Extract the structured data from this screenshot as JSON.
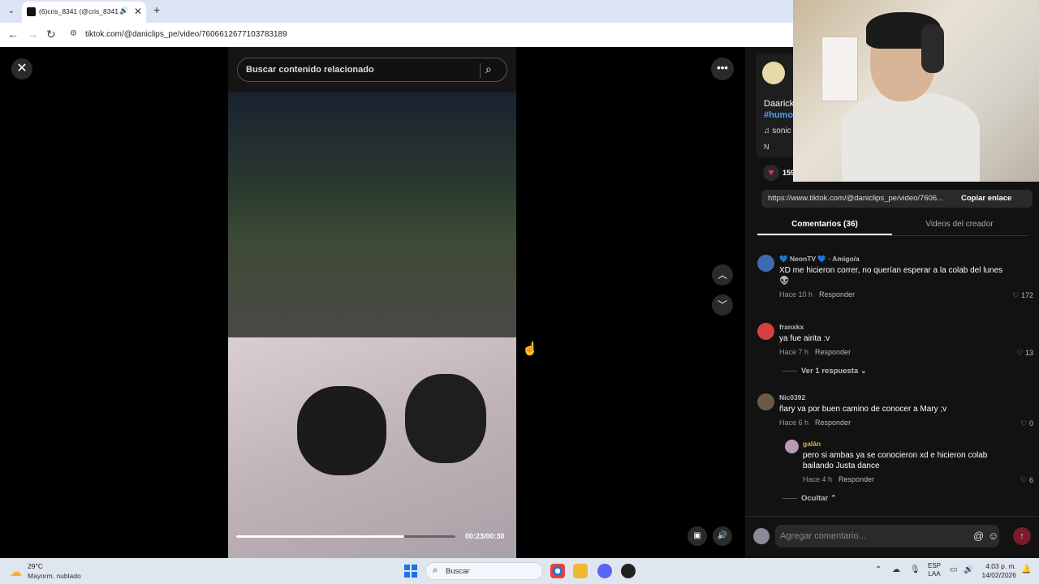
{
  "browser": {
    "tab_title": "(6)cris_8341 (@cris_8341) |",
    "url": "tiktok.com/@daniclips_pe/video/7606612677103783189"
  },
  "video": {
    "search_placeholder": "Buscar contenido relacionado",
    "time": "00:23/00:30",
    "progress_fraction": 0.767
  },
  "panel": {
    "creator_desc": "Daarick",
    "hashtag": "#humo",
    "music": "♫ sonic",
    "badge": "N",
    "likes": "159",
    "link_url": "https://www.tiktok.com/@daniclips_pe/video/7606...",
    "copy_link_label": "Copiar enlace",
    "tabs": [
      "Comentarios (36)",
      "Videos del creador"
    ]
  },
  "comments": [
    {
      "user": "💙 NeonTV 💙 · Amigo/a",
      "text": "XD me hicieron correr, no querían esperar a la colab del lunes 👽",
      "time": "Hace 10 h",
      "reply": "Responder",
      "likes": "172"
    },
    {
      "user": "franxkx",
      "text": "ya fue airita :v",
      "time": "Hace 7 h",
      "reply": "Responder",
      "likes": "13"
    },
    {
      "user": "Nic0392",
      "text": "ñary va por buen camino de conocer a Mary ;v",
      "time": "Hace 6 h",
      "reply": "Responder",
      "likes": "0"
    },
    {
      "user": "galán",
      "text": "pero si ambas ya se conocieron xd e hicieron colab bailando Justa dance",
      "time": "Hace 4 h",
      "reply": "Responder",
      "likes": "6"
    }
  ],
  "view_reply": "Ver 1 respuesta ⌄",
  "hide_label": "Ocultar ⌃",
  "composer": {
    "placeholder": "Agregar comentario..."
  },
  "taskbar": {
    "temp": "29°C",
    "weather": "Mayorm. nublado",
    "search": "Buscar",
    "lang1": "ESP",
    "lang2": "LAA",
    "time": "4:03 p. m.",
    "date": "14/02/2026"
  }
}
